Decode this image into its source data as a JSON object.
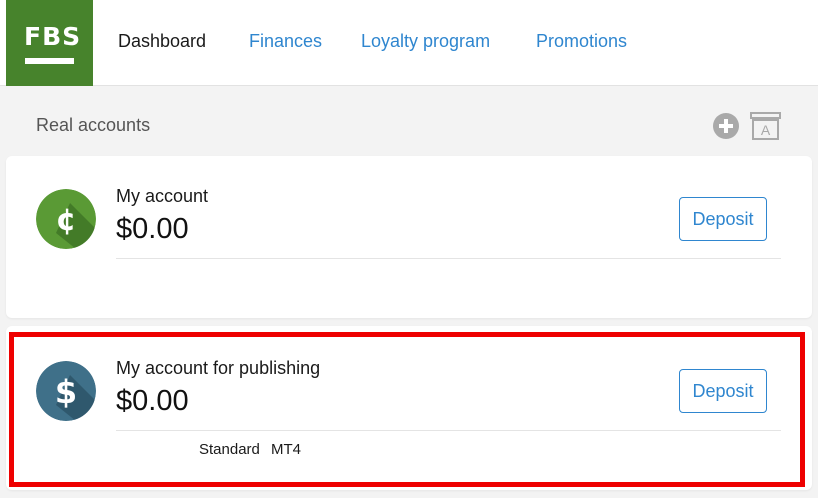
{
  "brand": {
    "logo_text": "FBS",
    "color": "#47832c"
  },
  "nav": {
    "items": [
      {
        "label": "Dashboard",
        "active": true
      },
      {
        "label": "Finances",
        "active": false
      },
      {
        "label": "Loyalty program",
        "active": false
      },
      {
        "label": "Promotions",
        "active": false
      }
    ]
  },
  "section": {
    "title": "Real accounts",
    "add_icon": "plus-circle-icon",
    "archive_icon": "archive-box-icon",
    "archive_letter": "A"
  },
  "accounts": [
    {
      "name": "My account",
      "balance": "$0.00",
      "currency_symbol": "¢",
      "icon": "cent-coin-icon",
      "icon_color": "#5a9a35",
      "deposit_label": "Deposit",
      "type": "",
      "platform": ""
    },
    {
      "name": "My account for publishing",
      "balance": "$0.00",
      "currency_symbol": "$",
      "icon": "dollar-coin-icon",
      "icon_color": "#3f7089",
      "deposit_label": "Deposit",
      "type": "Standard",
      "platform": "MT4"
    }
  ],
  "colors": {
    "accent": "#2f86cf",
    "highlight": "#ee0000"
  }
}
